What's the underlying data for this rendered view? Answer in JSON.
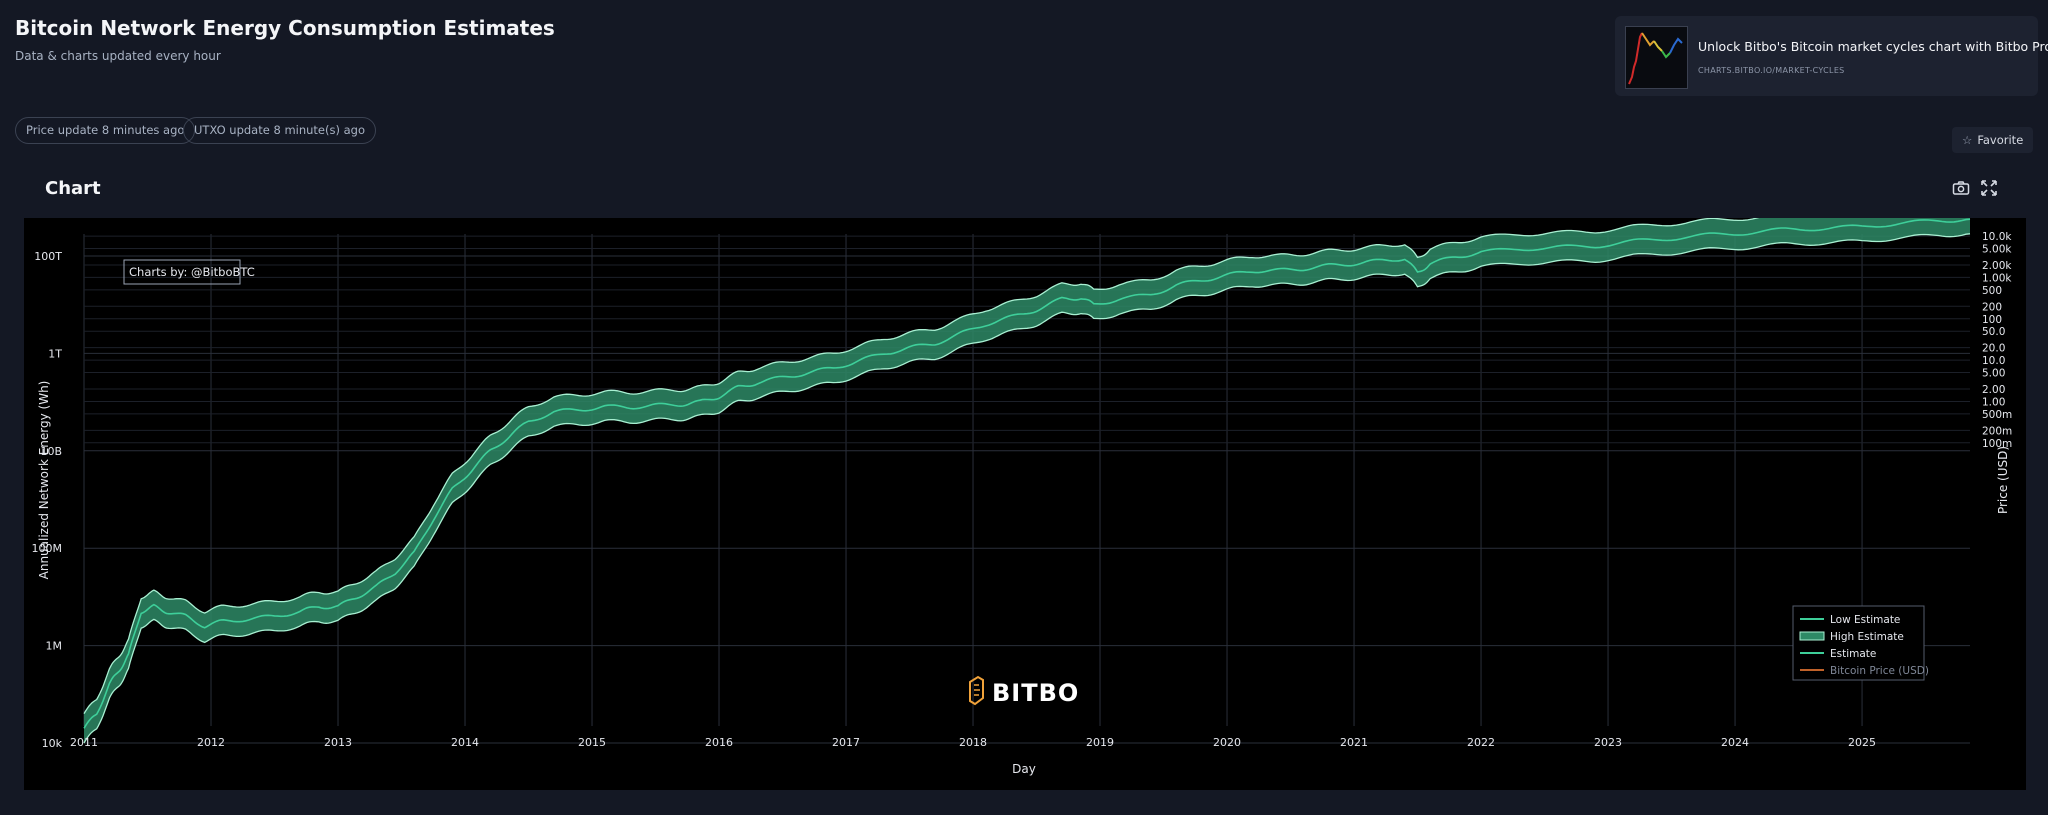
{
  "header": {
    "title": "Bitcoin Network Energy Consumption Estimates",
    "subtitle": "Data & charts updated every hour"
  },
  "promo": {
    "title": "Unlock Bitbo's Bitcoin market cycles chart with Bitbo Pro.",
    "url": "CHARTS.BITBO.IO/MARKET-CYCLES"
  },
  "status": {
    "price_update": "Price update 8 minutes ago",
    "utxo_update": "UTXO update 8 minute(s) ago"
  },
  "favorite_label": "Favorite",
  "chart_heading": "Chart",
  "icons": {
    "favorite": "star-icon",
    "screenshot": "camera-icon",
    "fullscreen": "expand-icon"
  },
  "colors": {
    "estimate": "#3ecf9a",
    "band_fill": "#2e8a66",
    "band_edge": "#a8f0d2",
    "price": "#c0622a",
    "legend_muted": "#7f8797"
  },
  "chart_data": {
    "type": "line",
    "watermark": "BITBO",
    "credit": "Charts by: @BitboBTC",
    "xlabel": "Day",
    "ylabel": "Annualized Network Energy (Wh)",
    "y2label": "Price (USD)",
    "xlim": [
      2011.0,
      2025.85
    ],
    "ylim_log10": [
      4,
      14
    ],
    "y2lim_log10": [
      -7.85,
      4.05
    ],
    "y_scale": "log",
    "y2_scale": "log",
    "grid": true,
    "legend_position": "bottom-right",
    "x_ticks": [
      "2011",
      "2012",
      "2013",
      "2014",
      "2015",
      "2016",
      "2017",
      "2018",
      "2019",
      "2020",
      "2021",
      "2022",
      "2023",
      "2024",
      "2025"
    ],
    "y_ticks": [
      {
        "label": "10k",
        "value": 10000.0
      },
      {
        "label": "1M",
        "value": 1000000.0
      },
      {
        "label": "100M",
        "value": 100000000.0
      },
      {
        "label": "10B",
        "value": 10000000000.0
      },
      {
        "label": "1T",
        "value": 1000000000000.0
      },
      {
        "label": "100T",
        "value": 100000000000000.0
      }
    ],
    "y2_ticks": [
      {
        "label": "100m",
        "value": 0.1
      },
      {
        "label": "200m",
        "value": 0.2
      },
      {
        "label": "500m",
        "value": 0.5
      },
      {
        "label": "1.00",
        "value": 1
      },
      {
        "label": "2.00",
        "value": 2
      },
      {
        "label": "5.00",
        "value": 5
      },
      {
        "label": "10.0",
        "value": 10
      },
      {
        "label": "20.0",
        "value": 20
      },
      {
        "label": "50.0",
        "value": 50
      },
      {
        "label": "100",
        "value": 100
      },
      {
        "label": "200",
        "value": 200
      },
      {
        "label": "500",
        "value": 500
      },
      {
        "label": "1.00k",
        "value": 1000
      },
      {
        "label": "2.00k",
        "value": 2000
      },
      {
        "label": "5.00k",
        "value": 5000
      },
      {
        "label": "10.0k",
        "value": 10000
      }
    ],
    "legend": [
      {
        "name": "Low Estimate",
        "style": "thin"
      },
      {
        "name": "High Estimate",
        "style": "band"
      },
      {
        "name": "Estimate",
        "style": "line"
      },
      {
        "name": "Bitcoin Price (USD)",
        "style": "muted"
      }
    ],
    "series": [
      {
        "name": "Estimate",
        "x": [
          2011.0,
          2011.1,
          2011.2,
          2011.28,
          2011.35,
          2011.45,
          2011.55,
          2011.65,
          2011.8,
          2011.95,
          2012.1,
          2012.3,
          2012.5,
          2012.7,
          2012.85,
          2013.0,
          2013.15,
          2013.3,
          2013.45,
          2013.6,
          2013.75,
          2013.9,
          2014.05,
          2014.2,
          2014.35,
          2014.5,
          2014.7,
          2014.9,
          2015.1,
          2015.3,
          2015.5,
          2015.7,
          2015.85,
          2016.0,
          2016.15,
          2016.3,
          2016.5,
          2016.7,
          2016.9,
          2017.1,
          2017.3,
          2017.5,
          2017.7,
          2017.9,
          2018.1,
          2018.3,
          2018.5,
          2018.7,
          2018.85,
          2018.95,
          2019.15,
          2019.4,
          2019.6,
          2019.8,
          2020.0,
          2020.2,
          2020.4,
          2020.6,
          2020.8,
          2021.0,
          2021.2,
          2021.4,
          2021.5,
          2021.6,
          2021.8,
          2022.0,
          2022.3,
          2022.6,
          2022.9,
          2023.2,
          2023.5,
          2023.8,
          2024.1,
          2024.4,
          2024.7,
          2025.0,
          2025.3,
          2025.6,
          2025.85
        ],
        "values": [
          20000.0,
          40000.0,
          160000.0,
          320000.0,
          630000.0,
          5000000.0,
          6300000.0,
          5000000.0,
          4000000.0,
          2500000.0,
          3200000.0,
          3500000.0,
          4000000.0,
          5000000.0,
          6300000.0,
          6300000.0,
          10000000.0,
          16000000.0,
          32000000.0,
          79000000.0,
          400000000.0,
          1600000000.0,
          4000000000.0,
          10000000000.0,
          20000000000.0,
          40000000000.0,
          63000000000.0,
          70000000000.0,
          80000000000.0,
          79000000000.0,
          85000000000.0,
          90000000000.0,
          100000000000.0,
          130000000000.0,
          200000000000.0,
          250000000000.0,
          320000000000.0,
          400000000000.0,
          500000000000.0,
          700000000000.0,
          1000000000000.0,
          1300000000000.0,
          1600000000000.0,
          2500000000000.0,
          4000000000000.0,
          5500000000000.0,
          7900000000000.0,
          13000000000000.0,
          14000000000000.0,
          10000000000000.0,
          13000000000000.0,
          16000000000000.0,
          25000000000000.0,
          32000000000000.0,
          40000000000000.0,
          50000000000000.0,
          50000000000000.0,
          55000000000000.0,
          63000000000000.0,
          70000000000000.0,
          79000000000000.0,
          90000000000000.0,
          45000000000000.0,
          70000000000000.0,
          95000000000000.0,
          120000000000000.0,
          140000000000000.0,
          150000000000000.0,
          160000000000000.0,
          200000000000000.0,
          230000000000000.0,
          270000000000000.0,
          300000000000000.0,
          350000000000000.0,
          370000000000000.0,
          400000000000000.0,
          470000000000000.0,
          530000000000000.0,
          570000000000000.0
        ]
      },
      {
        "name": "Low Estimate",
        "relative_to_estimate": 0.5
      },
      {
        "name": "High Estimate",
        "relative_to_estimate": 2.0
      }
    ]
  }
}
